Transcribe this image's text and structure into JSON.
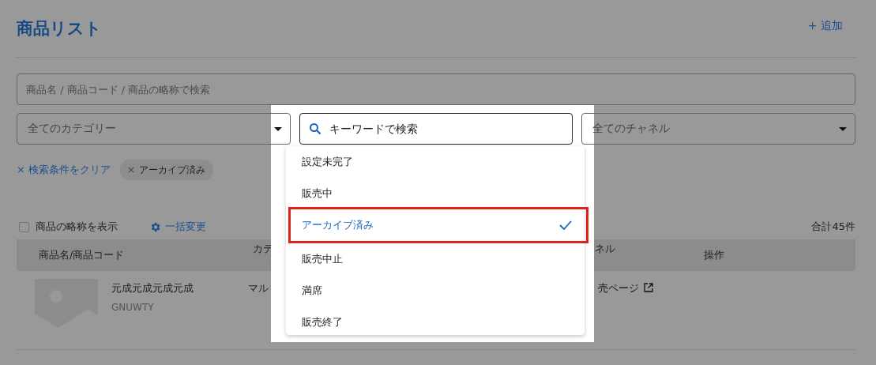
{
  "header": {
    "title": "商品リスト",
    "add_button": "+ 追加"
  },
  "keyword_search": {
    "placeholder": "商品名 / 商品コード / 商品の略称で検索"
  },
  "category_filter": {
    "value": "全てのカテゴリー"
  },
  "channel_filter": {
    "value": "全てのチャネル"
  },
  "clear_filters": "× 検索条件をクリア",
  "filter_chips": [
    {
      "label": "アーカイブ済み"
    }
  ],
  "show_abbreviation": {
    "label": "商品の略称を表示",
    "checked": false
  },
  "bulk_edit": "一括変更",
  "total": "合計45件",
  "table": {
    "columns": [
      "商品名/商品コード",
      "カテ",
      "ネル",
      "操作"
    ],
    "rows": [
      {
        "name": "元成元成元成元成",
        "code": "GNUWTY",
        "category": "マル",
        "channel_link": "売ページ"
      }
    ]
  },
  "status_dropdown": {
    "search": {
      "placeholder": "キーワードで検索"
    },
    "options": [
      {
        "label": "設定未完了",
        "selected": false,
        "highlighted": false
      },
      {
        "label": "販売中",
        "selected": false,
        "highlighted": false
      },
      {
        "label": "アーカイブ済み",
        "selected": true,
        "highlighted": true
      },
      {
        "label": "販売中止",
        "selected": false,
        "highlighted": false
      },
      {
        "label": "満席",
        "selected": false,
        "highlighted": false
      },
      {
        "label": "販売終了",
        "selected": false,
        "highlighted": false
      }
    ]
  }
}
